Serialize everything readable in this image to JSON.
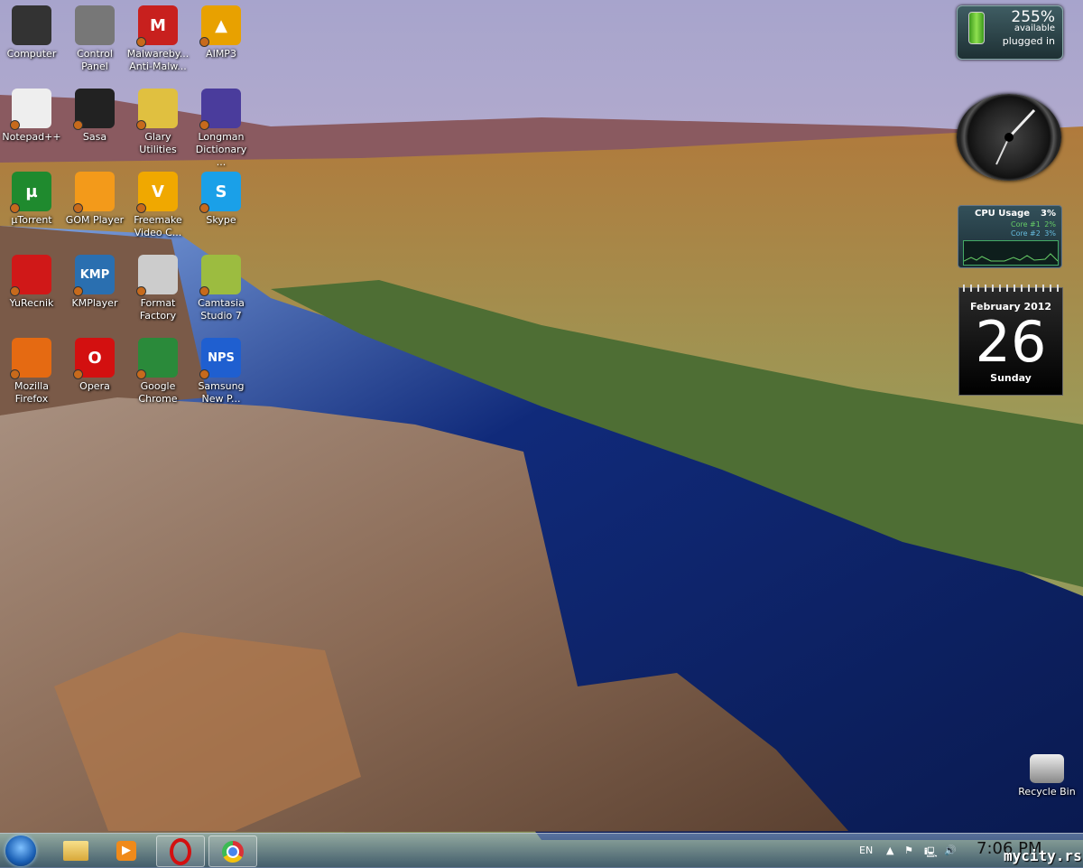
{
  "desktop_icons": [
    {
      "label": "Computer",
      "color": "#333"
    },
    {
      "label": "Control\nPanel",
      "color": "#777"
    },
    {
      "label": "Malwareby...\nAnti-Malw...",
      "color": "#c8201e",
      "glyph": "M"
    },
    {
      "label": "AIMP3",
      "color": "#e8a100",
      "glyph": "▲"
    },
    {
      "label": "Notepad++",
      "color": "#eee"
    },
    {
      "label": "Sasa",
      "color": "#222"
    },
    {
      "label": "Glary Utilities",
      "color": "#e0c040"
    },
    {
      "label": "Longman\nDictionary ...",
      "color": "#4a3c9c"
    },
    {
      "label": "µTorrent",
      "color": "#1f8a2e",
      "glyph": "µ"
    },
    {
      "label": "GOM Player",
      "color": "#f39a1a"
    },
    {
      "label": "Freemake\nVideo C...",
      "color": "#f0a800",
      "glyph": "V"
    },
    {
      "label": "Skype",
      "color": "#1aa0e8",
      "glyph": "S"
    },
    {
      "label": "YuRecnik",
      "color": "#d01818"
    },
    {
      "label": "KMPlayer",
      "color": "#2a6fb0",
      "glyph": "KMP"
    },
    {
      "label": "Format\nFactory",
      "color": "#ccc"
    },
    {
      "label": "Camtasia\nStudio 7",
      "color": "#9cbc40"
    },
    {
      "label": "Mozilla\nFirefox",
      "color": "#e56a12"
    },
    {
      "label": "Opera",
      "color": "#d31010",
      "glyph": "O"
    },
    {
      "label": "Google\nChrome",
      "color": "#2a8a3a"
    },
    {
      "label": "Samsung\nNew P...",
      "color": "#1f5fd0",
      "glyph": "NPS"
    }
  ],
  "recycle_bin": {
    "label": "Recycle Bin"
  },
  "gadgets": {
    "battery": {
      "percent": "255%",
      "available": "available",
      "status": "plugged in"
    },
    "cpu": {
      "title": "CPU Usage",
      "total": "3%",
      "cores": [
        {
          "name": "Core #1",
          "value": "2%"
        },
        {
          "name": "Core #2",
          "value": "3%"
        }
      ]
    },
    "calendar": {
      "month": "February 2012",
      "day": "26",
      "weekday": "Sunday"
    }
  },
  "taskbar": {
    "pinned": [
      "Windows Explorer",
      "Windows Media Player",
      "Opera",
      "Google Chrome"
    ],
    "language": "EN",
    "time": "7:06 PM"
  },
  "watermark": "mycity.rs"
}
